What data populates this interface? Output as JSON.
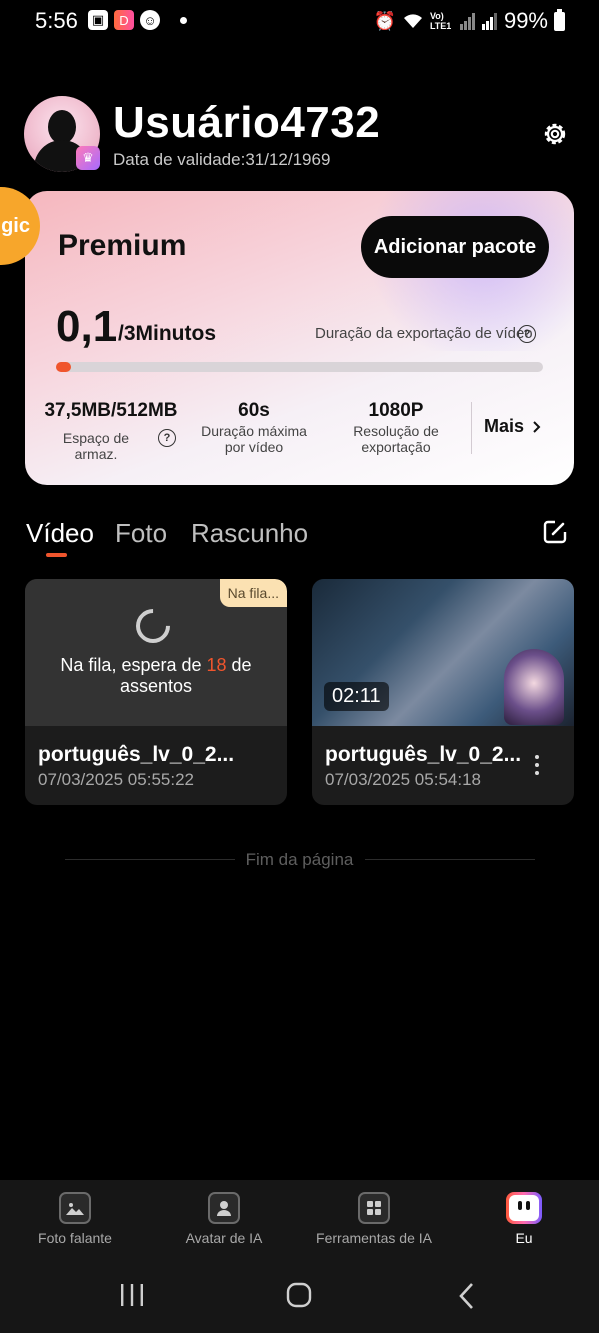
{
  "status_bar": {
    "time": "5:56",
    "battery": "99%",
    "network": "Vo) LTE1"
  },
  "profile": {
    "username": "Usuário4732",
    "validity": "Data de validade:31/12/1969"
  },
  "card": {
    "badge": "gic",
    "plan": "Premium",
    "add_package": "Adicionar pacote",
    "usage_value": "0,1",
    "usage_total": "/3Minutos",
    "export_label": "Duração da exportação de vídeo",
    "progress_fraction": 0.03,
    "stats": [
      {
        "value": "37,5MB/512MB",
        "label": "Espaço de armaz."
      },
      {
        "value": "60s",
        "label": "Duração máxima por vídeo"
      },
      {
        "value": "1080P",
        "label": "Resolução de exportação"
      }
    ],
    "more": "Mais"
  },
  "tabs": [
    "Vídeo",
    "Foto",
    "Rascunho"
  ],
  "videos": [
    {
      "badge": "Na fila...",
      "queue_text_pre": "Na fila, espera de ",
      "queue_num": "18",
      "queue_text_post": " de assentos",
      "title": "português_lv_0_2...",
      "date": "07/03/2025 05:55:22"
    },
    {
      "duration": "02:11",
      "title": "português_lv_0_2...",
      "date": "07/03/2025 05:54:18"
    }
  ],
  "end_text": "Fim da página",
  "bottom_nav": [
    {
      "label": "Foto falante",
      "icon": "image-icon"
    },
    {
      "label": "Avatar de IA",
      "icon": "avatar-icon"
    },
    {
      "label": "Ferramentas de IA",
      "icon": "grid-icon"
    },
    {
      "label": "Eu",
      "icon": "face-icon"
    }
  ]
}
